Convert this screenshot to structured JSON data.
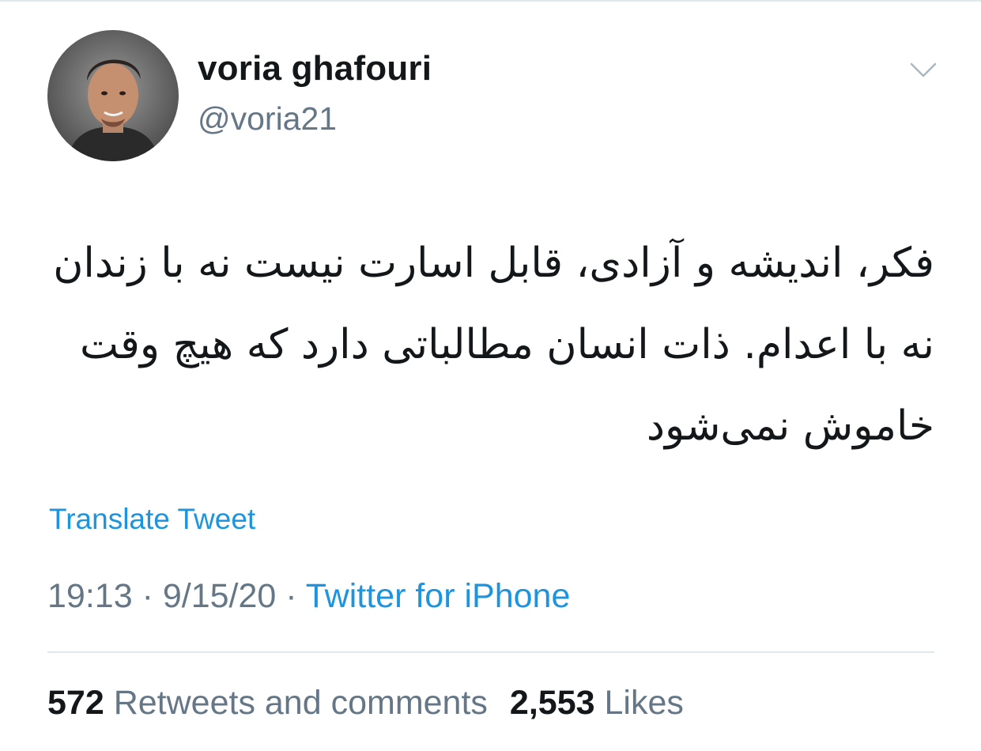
{
  "tweet": {
    "author": {
      "name": "voria ghafouri",
      "handle": "@voria21",
      "avatar_icon": "profile-photo"
    },
    "menu_icon": "chevron-down-icon",
    "text": "فکر، اندیشه و آزادی، قابل اسارت نیست نه با زندان نه با اعدام. ذات انسان مطالباتی دارد که هیچ وقت خاموش نمی‌شود",
    "translate_label": "Translate Tweet",
    "time": "19:13",
    "separator": "·",
    "date": "9/15/20",
    "source": "Twitter for iPhone",
    "stats": {
      "retweets_count": "572",
      "retweets_label": "Retweets and comments",
      "likes_count": "2,553",
      "likes_label": "Likes"
    }
  },
  "colors": {
    "text_primary": "#14171a",
    "text_secondary": "#657786",
    "link": "#1b95e0",
    "divider": "#e1e8ed"
  }
}
